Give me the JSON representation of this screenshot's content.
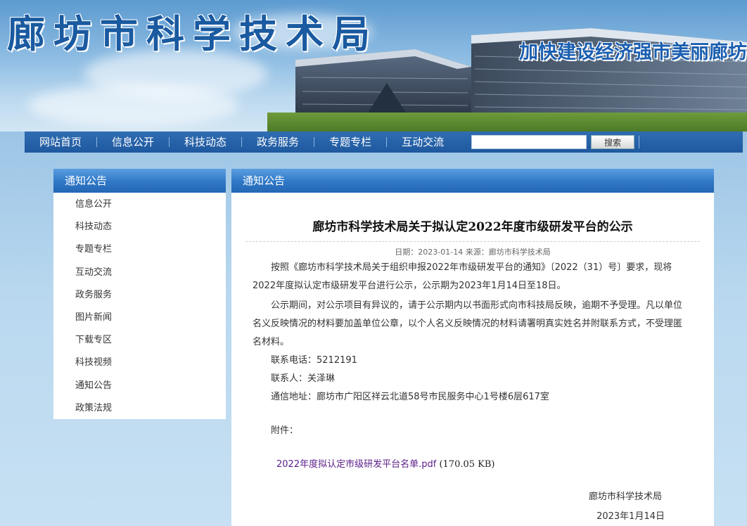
{
  "header": {
    "site_title": "廊坊市科学技术局",
    "slogan": "加快建设经济强市美丽廊坊"
  },
  "nav": {
    "items": [
      "网站首页",
      "信息公开",
      "科技动态",
      "政务服务",
      "专题专栏",
      "互动交流"
    ],
    "search_value": "",
    "search_button": "搜索"
  },
  "sidebar": {
    "title": "通知公告",
    "items": [
      "信息公开",
      "科技动态",
      "专题专栏",
      "互动交流",
      "政务服务",
      "图片新闻",
      "下载专区",
      "科技视频",
      "通知公告",
      "政策法规"
    ]
  },
  "main": {
    "section_title": "通知公告",
    "article": {
      "title": "廊坊市科学技术局关于拟认定2022年度市级研发平台的公示",
      "meta": "日期：2023-01-14 来源：廊坊市科学技术局",
      "para1": "按照《廊坊市科学技术局关于组织申报2022年市级研发平台的通知》〔2022（31）号〕要求，现将2022年度拟认定市级研发平台进行公示，公示期为2023年1月14日至18日。",
      "para2": "公示期间，对公示项目有异议的，请于公示期内以书面形式向市科技局反映，逾期不予受理。凡以单位名义反映情况的材料要加盖单位公章，以个人名义反映情况的材料请署明真实姓名并附联系方式，不受理匿名材料。",
      "phone": "联系电话：5212191",
      "contact": "联系人：关泽琳",
      "address": "通信地址：廊坊市广阳区祥云北道58号市民服务中心1号楼6层617室",
      "attachment_label": "附件：",
      "attachment_name": "2022年度拟认定市级研发平台名单.pdf",
      "attachment_size": "(170.05 KB)",
      "signature": "廊坊市科学技术局",
      "sign_date": "2023年1月14日"
    }
  },
  "colors": {
    "nav_bg": "#2466b4",
    "panel_head": "#2f78c6",
    "title_blue": "#1a5aa0",
    "link_purple": "#5a1d8a"
  }
}
